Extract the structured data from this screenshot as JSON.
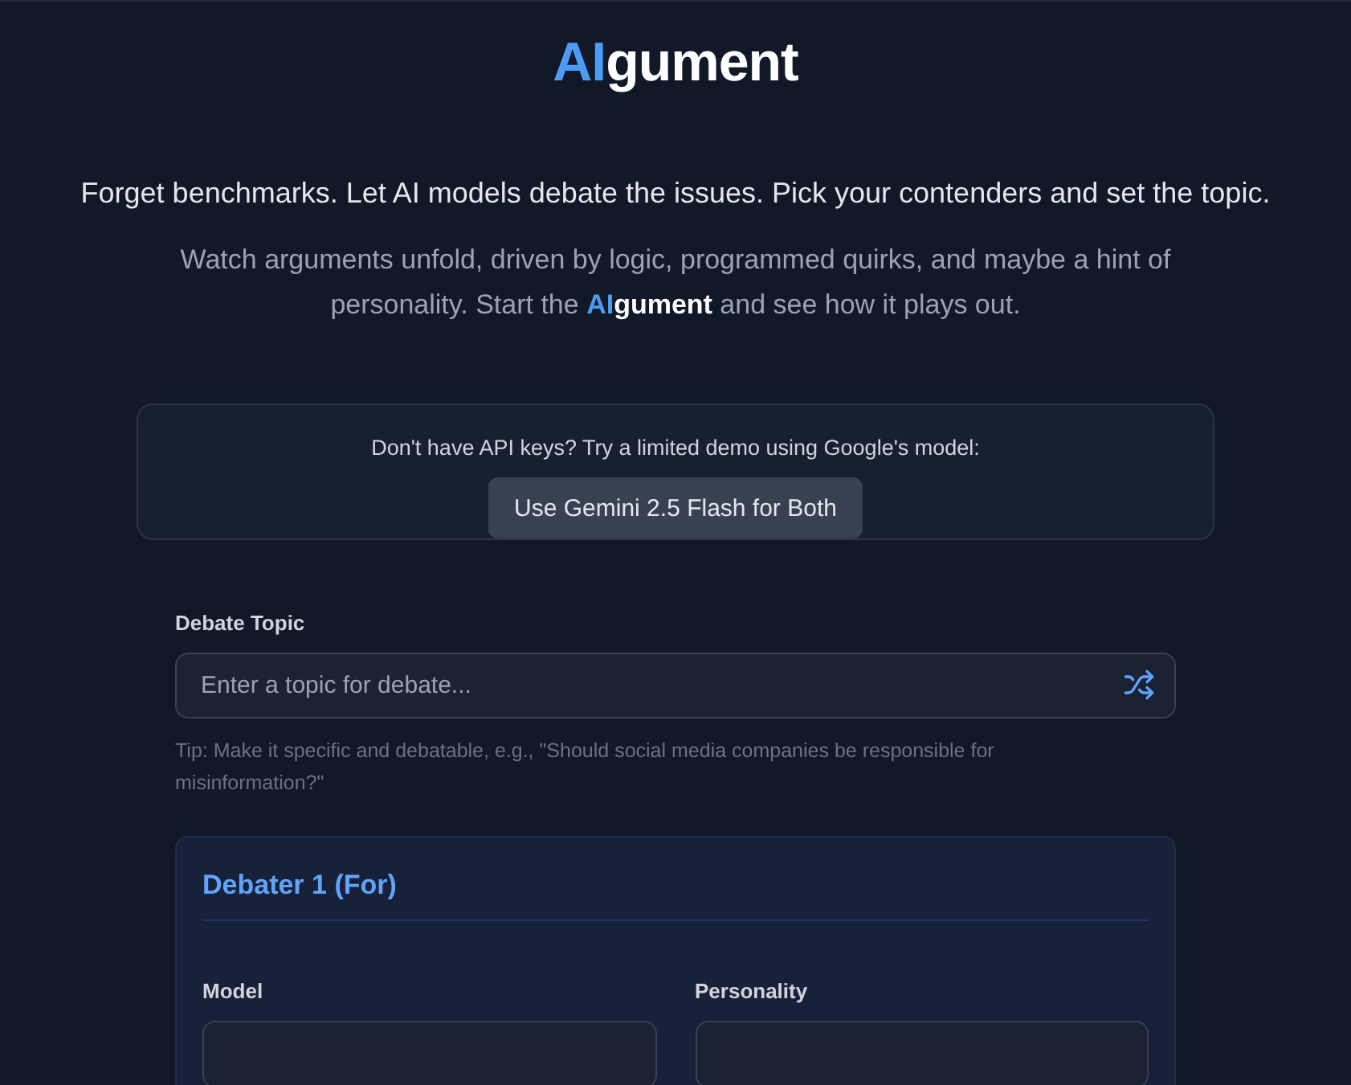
{
  "header": {
    "title": {
      "accent": "AI",
      "rest": "gument"
    }
  },
  "intro": {
    "tagline": "Forget benchmarks. Let AI models debate the issues. Pick your contenders and set the topic.",
    "description": {
      "before": "Watch arguments unfold, driven by logic, programmed quirks, and maybe a hint of personality. Start the ",
      "brand_accent": "AI",
      "brand_rest": "gument",
      "after": " and see how it plays out."
    }
  },
  "demo": {
    "text": "Don't have API keys? Try a limited demo using Google's model:",
    "button": "Use Gemini 2.5 Flash for Both"
  },
  "topic": {
    "label": "Debate Topic",
    "placeholder": "Enter a topic for debate...",
    "tip": "Tip: Make it specific and debatable, e.g., \"Should social media companies be responsible for misinformation?\""
  },
  "debaters": [
    {
      "title": "Debater 1 (For)",
      "fields": [
        {
          "label": "Model"
        },
        {
          "label": "Personality"
        }
      ]
    }
  ]
}
